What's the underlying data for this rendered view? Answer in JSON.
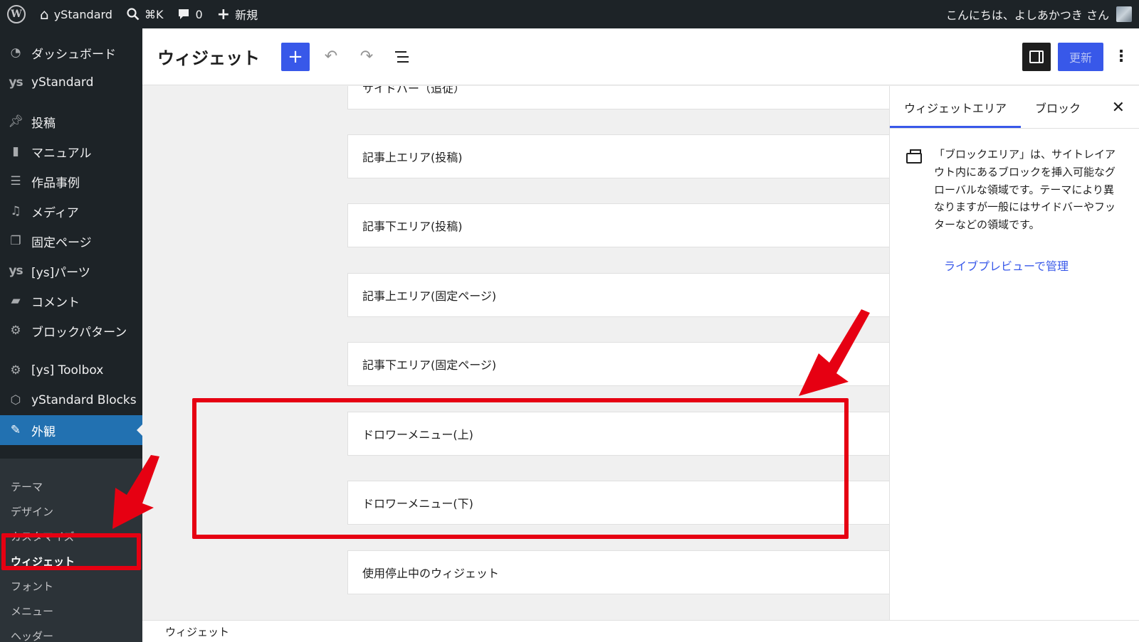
{
  "adminbar": {
    "site_name": "yStandard",
    "search_shortcut": "⌘K",
    "comments_count": "0",
    "new_label": "新規",
    "greeting": "こんにちは、よしあかつき さん"
  },
  "menu": {
    "items": [
      {
        "label": "ダッシュボード",
        "icon": "dashboard-icon"
      },
      {
        "label": "yStandard",
        "icon": "ys-icon"
      },
      {
        "label": "投稿",
        "icon": "pin-icon"
      },
      {
        "label": "マニュアル",
        "icon": "book-icon"
      },
      {
        "label": "作品事例",
        "icon": "list-icon"
      },
      {
        "label": "メディア",
        "icon": "media-icon"
      },
      {
        "label": "固定ページ",
        "icon": "pages-icon"
      },
      {
        "label": "[ys]パーツ",
        "icon": "ys-icon"
      },
      {
        "label": "コメント",
        "icon": "comment-icon"
      },
      {
        "label": "ブロックパターン",
        "icon": "gear-icon"
      },
      {
        "label": "[ys] Toolbox",
        "icon": "gear-icon"
      },
      {
        "label": "yStandard Blocks",
        "icon": "cube-icon"
      },
      {
        "label": "外観",
        "icon": "brush-icon"
      }
    ],
    "submenu": [
      "テーマ",
      "デザイン",
      "カスタマイズ",
      "ウィジェット",
      "フォント",
      "メニュー",
      "ヘッダー"
    ]
  },
  "header": {
    "title": "ウィジェット",
    "update_label": "更新"
  },
  "areas": [
    "サイドバー（追従）",
    "記事上エリア(投稿)",
    "記事下エリア(投稿)",
    "記事上エリア(固定ページ)",
    "記事下エリア(固定ページ)",
    "ドロワーメニュー(上)",
    "ドロワーメニュー(下)",
    "使用停止中のウィジェット"
  ],
  "sidebar": {
    "tab_area": "ウィジェットエリア",
    "tab_block": "ブロック",
    "description": "「ブロックエリア」は、サイトレイアウト内にあるブロックを挿入可能なグローバルな領域です。テーマにより異なりますが一般にはサイドバーやフッターなどの領域です。",
    "link": "ライブプレビューで管理"
  },
  "footer": {
    "breadcrumb": "ウィジェット"
  },
  "colors": {
    "admin_bg": "#1d2327",
    "accent": "#3858e9",
    "menu_current": "#2271b1",
    "annotation": "#e60012"
  }
}
